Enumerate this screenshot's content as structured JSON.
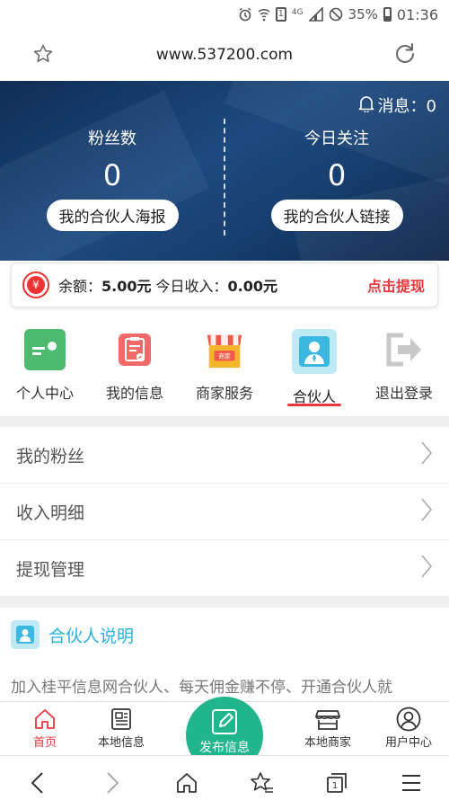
{
  "status_bar": {
    "network": "4G",
    "sim": "1",
    "battery_percent": "35%",
    "time": "01:36"
  },
  "browser": {
    "url": "www.537200.com"
  },
  "hero": {
    "messages_label": "消息：0",
    "fans": {
      "label": "粉丝数",
      "count": "0",
      "button": "我的合伙人海报"
    },
    "today": {
      "label": "今日关注",
      "count": "0",
      "button": "我的合伙人链接"
    }
  },
  "balance": {
    "currency_symbol": "¥",
    "balance_label": "余额：",
    "balance_value": "5.00元",
    "income_label": "今日收入：",
    "income_value": "0.00元",
    "withdraw_label": "点击提现"
  },
  "menu": [
    {
      "label": "个人中心",
      "icon": "id-card-icon",
      "color": "#4cba6f"
    },
    {
      "label": "我的信息",
      "icon": "clipboard-icon",
      "color": "#f06a6a"
    },
    {
      "label": "商家服务",
      "icon": "shop-icon",
      "color": "#f3b52a",
      "badge": "商家"
    },
    {
      "label": "合伙人",
      "icon": "partner-icon",
      "color": "#3cb8e0",
      "active": true
    },
    {
      "label": "退出登录",
      "icon": "logout-icon",
      "color": "#cfcfcf"
    }
  ],
  "list": [
    {
      "label": "我的粉丝"
    },
    {
      "label": "收入明细"
    },
    {
      "label": "提现管理"
    }
  ],
  "partner": {
    "title": "合伙人说明",
    "description": "加入桂平信息网合伙人、每天佣金赚不停、开通合伙人就"
  },
  "tabbar": {
    "home": "首页",
    "local_info": "本地信息",
    "publish": "发布信息",
    "local_merchants": "本地商家",
    "user_center": "用户中心"
  },
  "colors": {
    "accent_red": "#e8373d",
    "publish_green": "#21b58b",
    "partner_blue": "#2bb0d9"
  }
}
